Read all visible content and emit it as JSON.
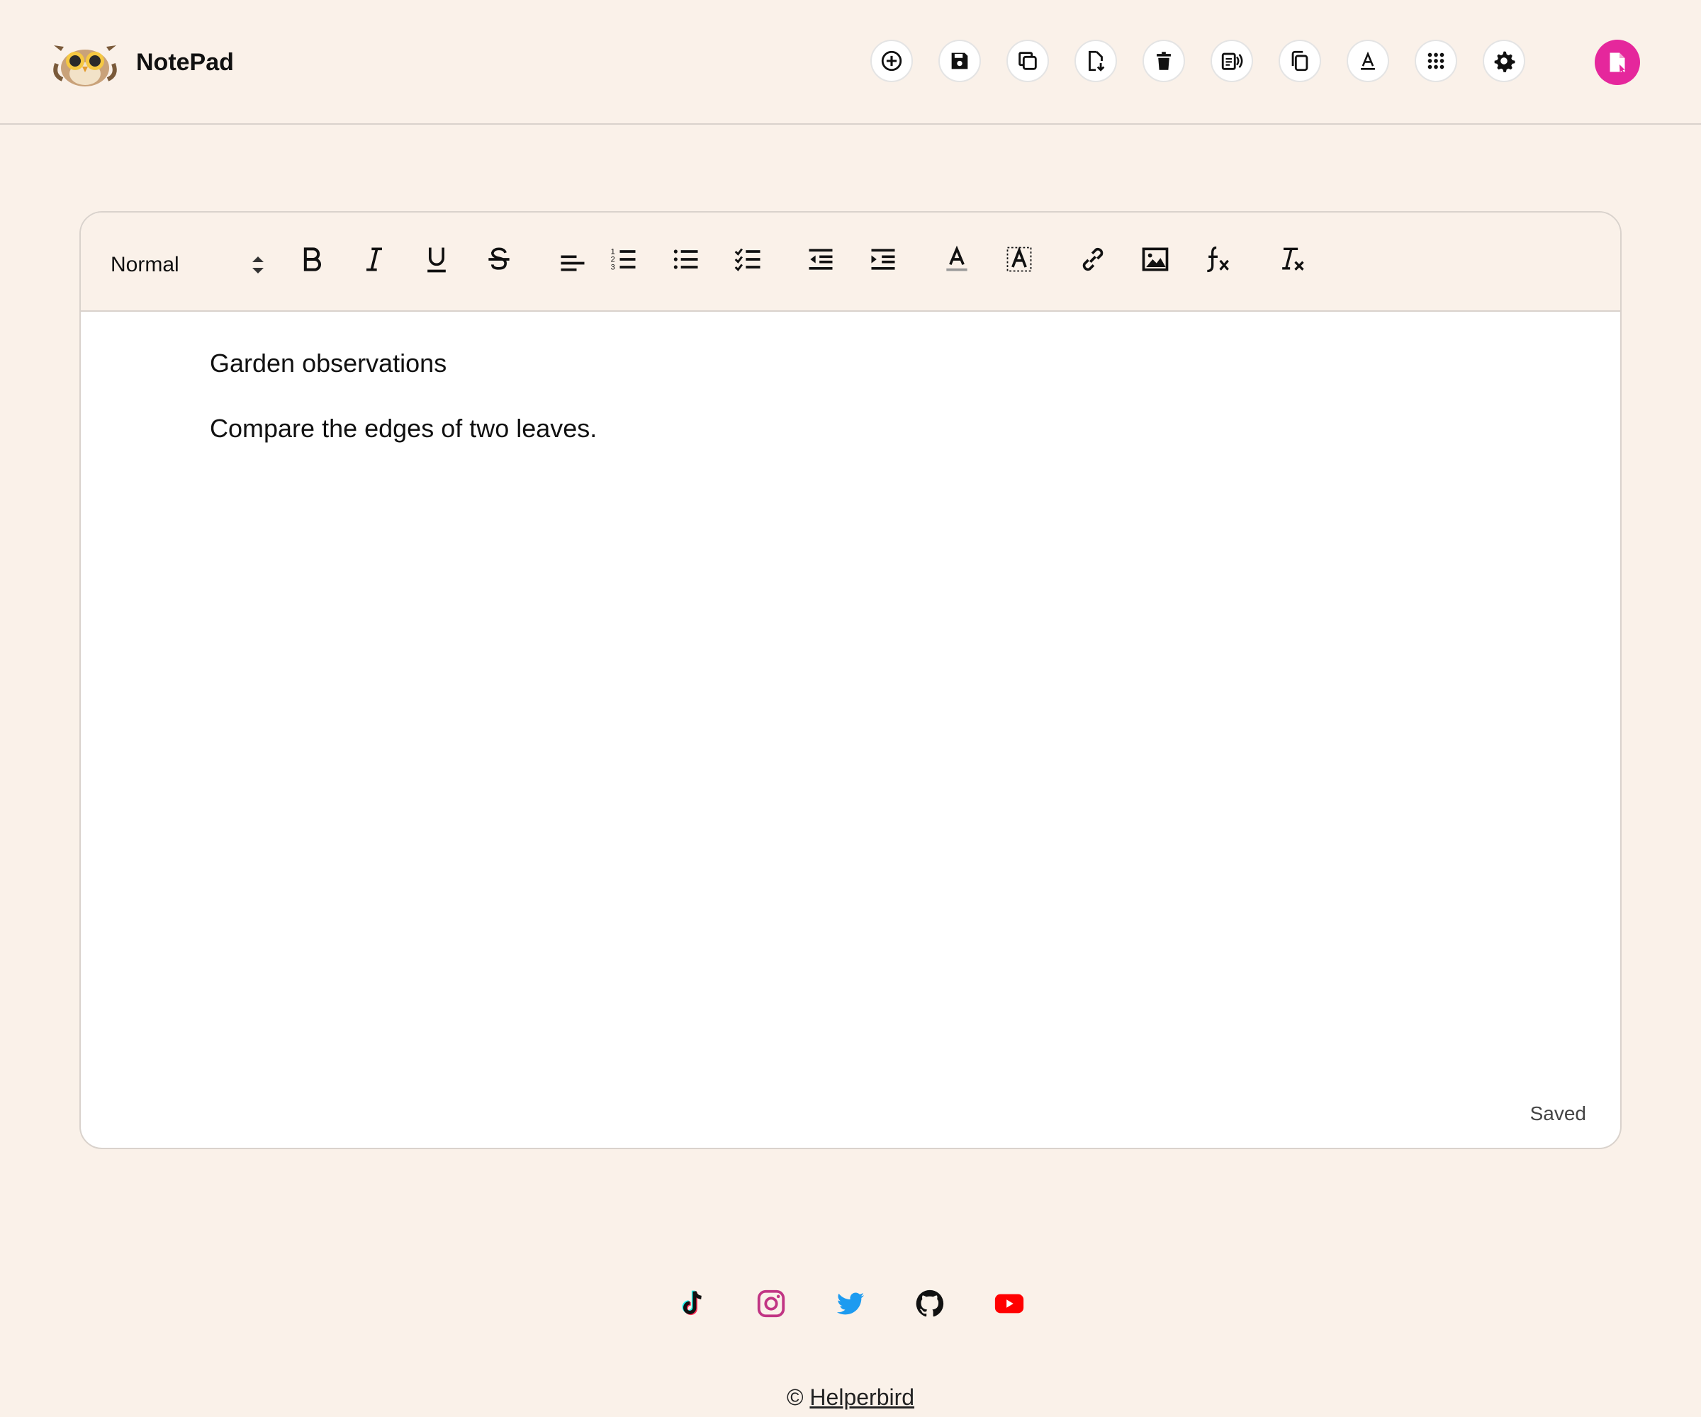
{
  "header": {
    "app_title": "NotePad",
    "actions": [
      {
        "name": "new-note-icon",
        "tooltip": "New note"
      },
      {
        "name": "save-icon",
        "tooltip": "Save"
      },
      {
        "name": "copy-icon",
        "tooltip": "Copy"
      },
      {
        "name": "download-icon",
        "tooltip": "Download"
      },
      {
        "name": "trash-icon",
        "tooltip": "Delete"
      },
      {
        "name": "text-to-speech-icon",
        "tooltip": "Read aloud"
      },
      {
        "name": "duplicate-icon",
        "tooltip": "Duplicate"
      },
      {
        "name": "font-icon",
        "tooltip": "Font"
      },
      {
        "name": "apps-grid-icon",
        "tooltip": "Apps"
      },
      {
        "name": "gear-icon",
        "tooltip": "Settings"
      }
    ],
    "accent_color": "#e5279c"
  },
  "editor": {
    "toolbar": {
      "format_value": "Normal",
      "tools": [
        "bold-icon",
        "italic-icon",
        "underline-icon",
        "strikethrough-icon",
        "align-left-icon",
        "ordered-list-icon",
        "bullet-list-icon",
        "checklist-icon",
        "outdent-icon",
        "indent-icon",
        "text-color-icon",
        "highlight-icon",
        "link-icon",
        "image-icon",
        "formula-icon",
        "clear-formatting-icon"
      ]
    },
    "content": {
      "line1": "Garden observations",
      "line2": "Compare the edges of two leaves."
    },
    "status": "Saved"
  },
  "socials": [
    "tiktok-icon",
    "instagram-icon",
    "twitter-icon",
    "github-icon",
    "youtube-icon"
  ],
  "footer": {
    "copyright_symbol": "©",
    "link_text": "Helperbird"
  }
}
